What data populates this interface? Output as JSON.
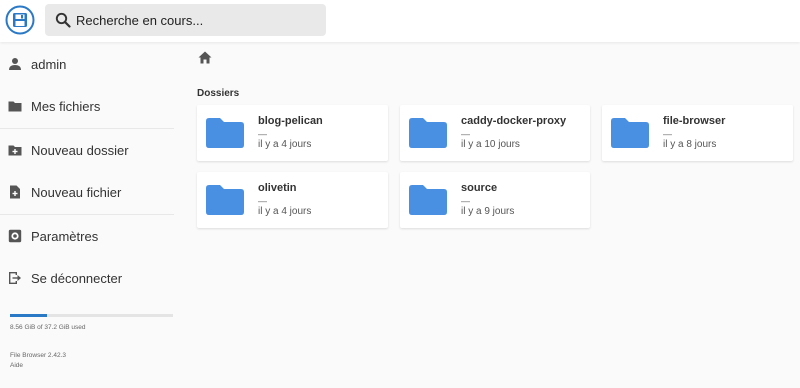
{
  "header": {
    "logo_icon": "file-browser-logo-icon",
    "search": {
      "placeholder": "Recherche en cours...",
      "value": "",
      "icon": "search-icon"
    }
  },
  "sidebar": {
    "items": [
      {
        "label": "admin",
        "icon": "person-icon"
      },
      {
        "label": "Mes fichiers",
        "icon": "folder-icon"
      },
      {
        "label": "Nouveau dossier",
        "icon": "new-folder-icon"
      },
      {
        "label": "Nouveau fichier",
        "icon": "new-file-icon"
      },
      {
        "label": "Paramètres",
        "icon": "gear-icon"
      },
      {
        "label": "Se déconnecter",
        "icon": "logout-icon"
      }
    ],
    "usage": {
      "text": "8.56 GiB of 37.2 GiB used",
      "fraction": 0.23
    },
    "version": "File Browser 2.42.3",
    "help": "Aide"
  },
  "main": {
    "breadcrumb_icon": "home-icon",
    "section_title": "Dossiers",
    "folders": [
      {
        "name": "blog-pelican",
        "size": "—",
        "modified": "il y a 4 jours"
      },
      {
        "name": "caddy-docker-proxy",
        "size": "—",
        "modified": "il y a 10 jours"
      },
      {
        "name": "file-browser",
        "size": "—",
        "modified": "il y a 8 jours"
      },
      {
        "name": "olivetin",
        "size": "—",
        "modified": "il y a 4 jours"
      },
      {
        "name": "source",
        "size": "—",
        "modified": "il y a 9 jours"
      }
    ]
  },
  "colors": {
    "accent": "#2979c7",
    "folder": "#4a90e2",
    "icon": "#555555"
  }
}
